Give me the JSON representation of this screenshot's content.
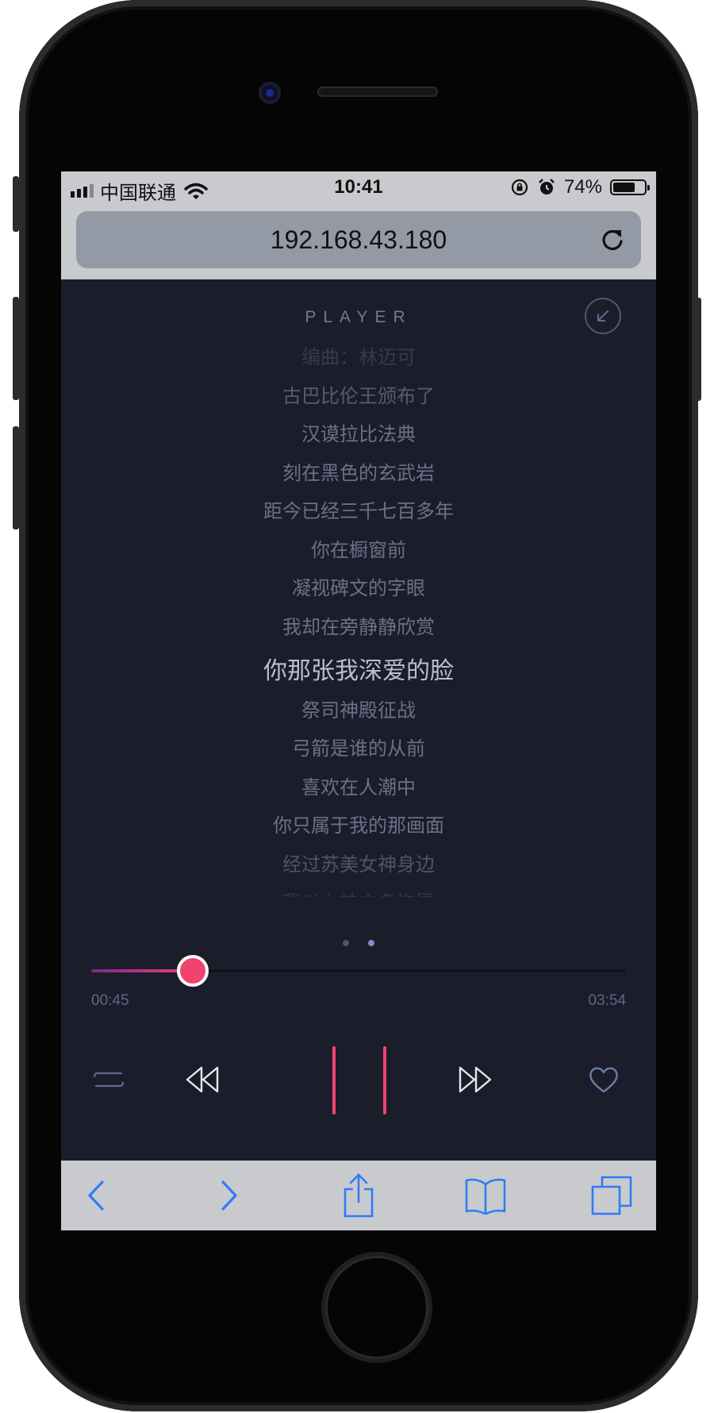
{
  "status_bar": {
    "carrier": "中国联通",
    "time": "10:41",
    "battery": "74%",
    "battery_level": 0.74,
    "icons": [
      "signal-icon",
      "wifi-icon",
      "orientation-lock-icon",
      "alarm-icon",
      "battery-icon"
    ]
  },
  "browser": {
    "url": "192.168.43.180",
    "reload_icon": "reload-icon",
    "toolbar": [
      "back-icon",
      "forward-icon",
      "share-icon",
      "bookmarks-icon",
      "tabs-icon"
    ]
  },
  "player": {
    "title": "PLAYER",
    "collapse_icon": "collapse-arrow-icon",
    "lyrics": [
      {
        "text": "编曲：林迈可",
        "opacity": 0.35
      },
      {
        "text": "古巴比伦王颁布了",
        "opacity": 0.75
      },
      {
        "text": "汉谟拉比法典",
        "opacity": 1
      },
      {
        "text": "刻在黑色的玄武岩",
        "opacity": 1
      },
      {
        "text": "距今已经三千七百多年",
        "opacity": 1
      },
      {
        "text": "你在橱窗前",
        "opacity": 1
      },
      {
        "text": "凝视碑文的字眼",
        "opacity": 1
      },
      {
        "text": "我却在旁静静欣赏",
        "opacity": 1
      },
      {
        "text": "你那张我深爱的脸",
        "opacity": 1,
        "active": true
      },
      {
        "text": "祭司神殿征战",
        "opacity": 1
      },
      {
        "text": "弓箭是谁的从前",
        "opacity": 1
      },
      {
        "text": "喜欢在人潮中",
        "opacity": 1
      },
      {
        "text": "你只属于我的那画面",
        "opacity": 1
      },
      {
        "text": "经过苏美女神身边",
        "opacity": 0.65
      },
      {
        "text": "我以女神之名许愿",
        "opacity": 0.3
      }
    ],
    "page_dots": 2,
    "active_dot": 1,
    "current_time": "00:45",
    "total_time": "03:54",
    "progress": 0.19,
    "controls": [
      "loop-icon",
      "previous-icon",
      "pause-icon",
      "next-icon",
      "heart-icon"
    ],
    "accent_color": "#f0436e"
  }
}
